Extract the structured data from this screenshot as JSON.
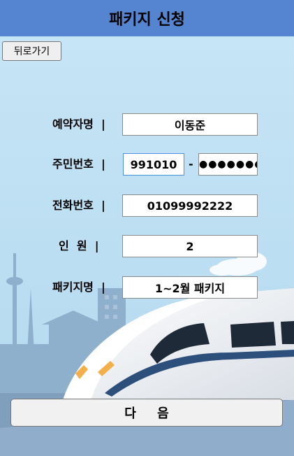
{
  "header": {
    "title": "패키지 신청"
  },
  "back_button": {
    "label": "뒤로가기"
  },
  "form": {
    "name": {
      "label": "예약자명  |",
      "value": "이동준"
    },
    "rrn": {
      "label": "주민번호  |",
      "front": "991010",
      "separator": "-",
      "back_masked": "●●●●●●●"
    },
    "phone": {
      "label": "전화번호  |",
      "value": "01099992222"
    },
    "people": {
      "label": "인  원  |",
      "value": "2"
    },
    "package": {
      "label": "패키지명  |",
      "value": "1~2월 패키지"
    }
  },
  "next_button": {
    "label": "다 음"
  },
  "colors": {
    "header": "#5585d0",
    "sky": "#bfe0f3",
    "city": "#8aa9c6",
    "train_body": "#f2f4f7"
  }
}
